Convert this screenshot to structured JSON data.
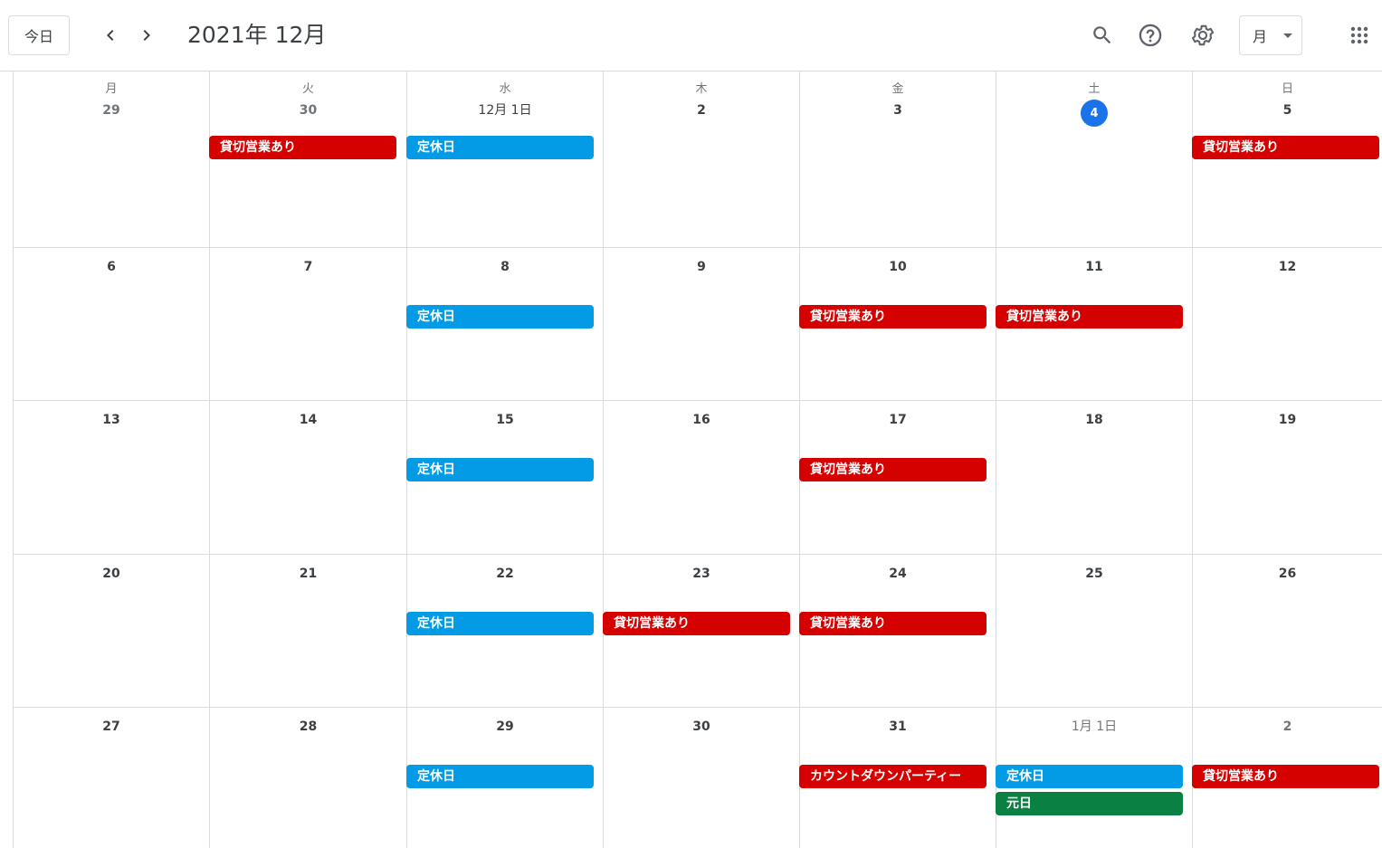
{
  "header": {
    "today_label": "今日",
    "title": "2021年 12月",
    "view_label": "月"
  },
  "colors": {
    "kashikiri": "#d50000",
    "teikyu": "#039be5",
    "ganjitsu": "#0b8043",
    "today_circle": "#1a73e8"
  },
  "weekdays": [
    "月",
    "火",
    "水",
    "木",
    "金",
    "土",
    "日"
  ],
  "weeks": [
    [
      {
        "label": "29",
        "other": true,
        "events": []
      },
      {
        "label": "30",
        "other": true,
        "events": [
          {
            "title": "貸切営業あり",
            "color": "#d50000"
          }
        ]
      },
      {
        "label": "12月 1日",
        "events": [
          {
            "title": "定休日",
            "color": "#039be5"
          }
        ]
      },
      {
        "label": "2",
        "events": []
      },
      {
        "label": "3",
        "events": []
      },
      {
        "label": "4",
        "today": true,
        "events": []
      },
      {
        "label": "5",
        "events": [
          {
            "title": "貸切営業あり",
            "color": "#d50000"
          }
        ]
      }
    ],
    [
      {
        "label": "6",
        "events": []
      },
      {
        "label": "7",
        "events": []
      },
      {
        "label": "8",
        "events": [
          {
            "title": "定休日",
            "color": "#039be5"
          }
        ]
      },
      {
        "label": "9",
        "events": []
      },
      {
        "label": "10",
        "events": [
          {
            "title": "貸切営業あり",
            "color": "#d50000"
          }
        ]
      },
      {
        "label": "11",
        "events": [
          {
            "title": "貸切営業あり",
            "color": "#d50000"
          }
        ]
      },
      {
        "label": "12",
        "events": []
      }
    ],
    [
      {
        "label": "13",
        "events": []
      },
      {
        "label": "14",
        "events": []
      },
      {
        "label": "15",
        "events": [
          {
            "title": "定休日",
            "color": "#039be5"
          }
        ]
      },
      {
        "label": "16",
        "events": []
      },
      {
        "label": "17",
        "events": [
          {
            "title": "貸切営業あり",
            "color": "#d50000"
          }
        ]
      },
      {
        "label": "18",
        "events": []
      },
      {
        "label": "19",
        "events": []
      }
    ],
    [
      {
        "label": "20",
        "events": []
      },
      {
        "label": "21",
        "events": []
      },
      {
        "label": "22",
        "events": [
          {
            "title": "定休日",
            "color": "#039be5"
          }
        ]
      },
      {
        "label": "23",
        "events": [
          {
            "title": "貸切営業あり",
            "color": "#d50000"
          }
        ]
      },
      {
        "label": "24",
        "events": [
          {
            "title": "貸切営業あり",
            "color": "#d50000"
          }
        ]
      },
      {
        "label": "25",
        "events": []
      },
      {
        "label": "26",
        "events": []
      }
    ],
    [
      {
        "label": "27",
        "events": []
      },
      {
        "label": "28",
        "events": []
      },
      {
        "label": "29",
        "events": [
          {
            "title": "定休日",
            "color": "#039be5"
          }
        ]
      },
      {
        "label": "30",
        "events": []
      },
      {
        "label": "31",
        "events": [
          {
            "title": "カウントダウンパーティー",
            "color": "#d50000"
          }
        ]
      },
      {
        "label": "1月 1日",
        "other": true,
        "events": [
          {
            "title": "定休日",
            "color": "#039be5"
          },
          {
            "title": "元日",
            "color": "#0b8043"
          }
        ]
      },
      {
        "label": "2",
        "other": true,
        "events": [
          {
            "title": "貸切営業あり",
            "color": "#d50000"
          }
        ]
      }
    ]
  ]
}
